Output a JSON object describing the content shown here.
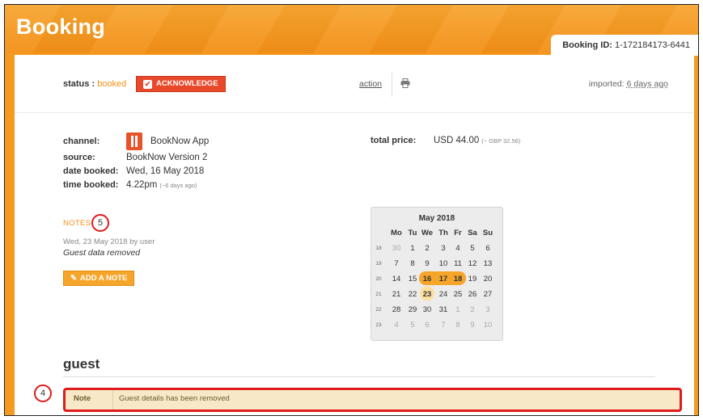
{
  "header": {
    "title": "Booking",
    "booking_id_label": "Booking ID:",
    "booking_id_value": "1-172184173-6441"
  },
  "status_row": {
    "status_label": "status :",
    "status_value": "booked",
    "acknowledge_label": "ACKNOWLEDGE",
    "action_label": "action",
    "imported_label": "imported:",
    "imported_value": "6 days ago"
  },
  "details": {
    "channel_label": "channel:",
    "channel_value": "BookNow App",
    "source_label": "source:",
    "source_value": "BookNow Version 2",
    "date_booked_label": "date booked:",
    "date_booked_value": "Wed, 16 May 2018",
    "time_booked_label": "time booked:",
    "time_booked_value": "4.22pm",
    "time_booked_rel": "(~6 days ago)",
    "total_price_label": "total price:",
    "total_price_value": "USD 44.00",
    "total_price_alt": "(~ GBP 32.56)"
  },
  "notes": {
    "title": "NOTES",
    "annotation_number": "5",
    "meta": "Wed, 23 May 2018 by user",
    "text": "Guest data removed",
    "add_note_label": "ADD A NOTE"
  },
  "calendar": {
    "title": "May 2018",
    "weekdays": [
      "Mo",
      "Tu",
      "We",
      "Th",
      "Fr",
      "Sa",
      "Su"
    ],
    "weeks": [
      {
        "num": "18",
        "days": [
          "30",
          "1",
          "2",
          "3",
          "4",
          "5",
          "6"
        ]
      },
      {
        "num": "19",
        "days": [
          "7",
          "8",
          "9",
          "10",
          "11",
          "12",
          "13"
        ]
      },
      {
        "num": "20",
        "days": [
          "14",
          "15",
          "16",
          "17",
          "18",
          "19",
          "20"
        ]
      },
      {
        "num": "21",
        "days": [
          "21",
          "22",
          "23",
          "24",
          "25",
          "26",
          "27"
        ]
      },
      {
        "num": "22",
        "days": [
          "28",
          "29",
          "30",
          "31",
          "1",
          "2",
          "3"
        ]
      },
      {
        "num": "23",
        "days": [
          "4",
          "5",
          "6",
          "7",
          "8",
          "9",
          "10"
        ]
      }
    ],
    "booked_days": [
      "16",
      "17",
      "18"
    ],
    "today": "23",
    "accent_color": "#f5a52a",
    "today_color": "#fbe0a0"
  },
  "guest": {
    "title": "guest",
    "annotation_number": "4",
    "note_label": "Note",
    "note_text": "Guest details has been removed"
  },
  "colors": {
    "brand_orange": "#f28f16",
    "acknowledge_red": "#e8492b",
    "annotation_red": "#e01b1b",
    "note_bg": "#f7e9c7"
  }
}
